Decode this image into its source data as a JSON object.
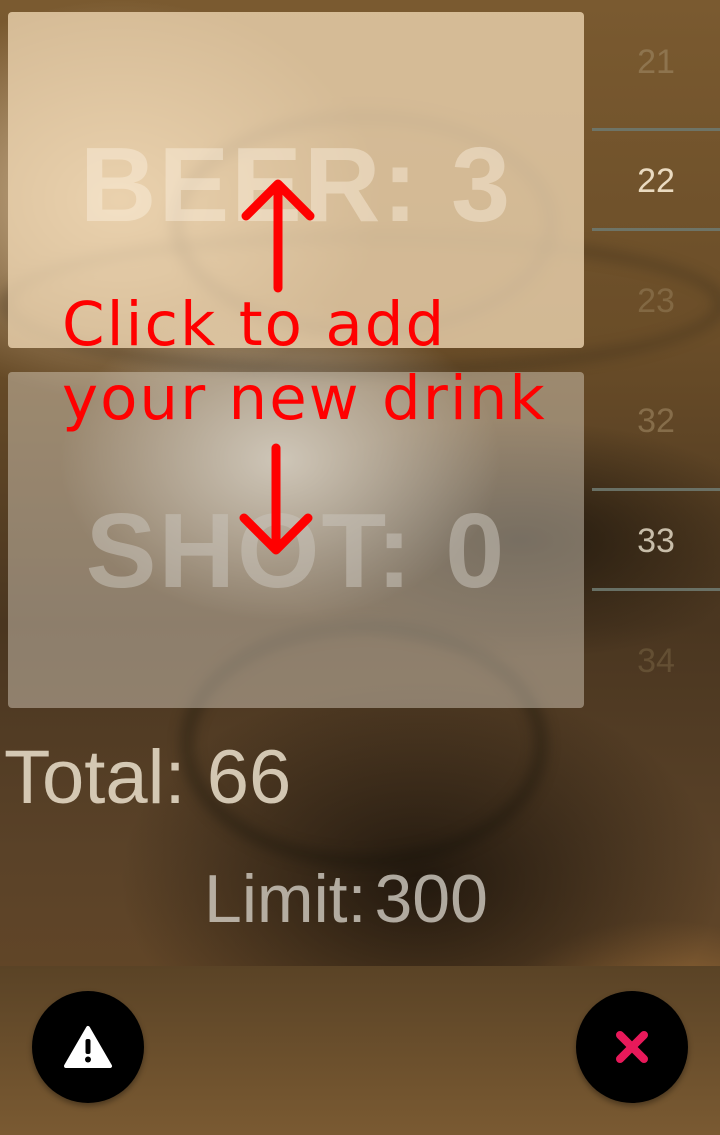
{
  "drinks": {
    "beer_label": "BEER: 3",
    "shot_label": "SHOT: 0"
  },
  "picker": {
    "items": [
      "21",
      "22",
      "23",
      "32",
      "33",
      "34"
    ]
  },
  "hint": {
    "line1": "Click to add",
    "line2": "your new drink"
  },
  "summary": {
    "total_label": "Total: 66",
    "limit_label": "Limit:",
    "limit_value": "300"
  },
  "actions": {
    "left_icon": "warning-icon",
    "right_icon": "close-icon"
  },
  "colors": {
    "hint": "#ff0000",
    "close_icon": "#e8195a",
    "fab_background": "#000000",
    "warning_icon": "#ffffff"
  }
}
